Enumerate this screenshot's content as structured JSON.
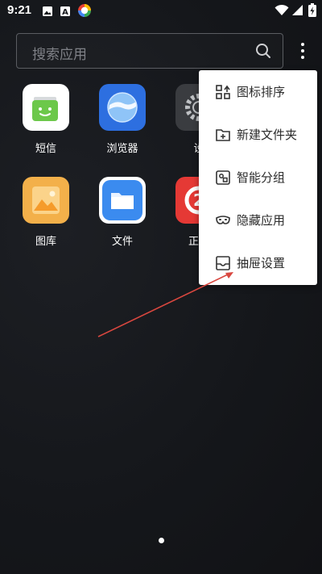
{
  "status_bar": {
    "time": "9:21"
  },
  "search": {
    "placeholder": "搜索应用"
  },
  "apps": [
    {
      "label": "短信"
    },
    {
      "label": "浏览器"
    },
    {
      "label": "设"
    },
    {
      "label": "图库"
    },
    {
      "label": "文件"
    },
    {
      "label": "正点"
    }
  ],
  "menu": {
    "items": [
      {
        "label": "图标排序",
        "icon": "grid-sort-icon"
      },
      {
        "label": "新建文件夹",
        "icon": "new-folder-icon"
      },
      {
        "label": "智能分组",
        "icon": "smart-group-icon"
      },
      {
        "label": "隐藏应用",
        "icon": "mask-icon"
      },
      {
        "label": "抽屉设置",
        "icon": "drawer-icon"
      }
    ]
  },
  "colors": {
    "annotation_arrow": "#d9473f",
    "menu_bg": "#ffffff"
  }
}
